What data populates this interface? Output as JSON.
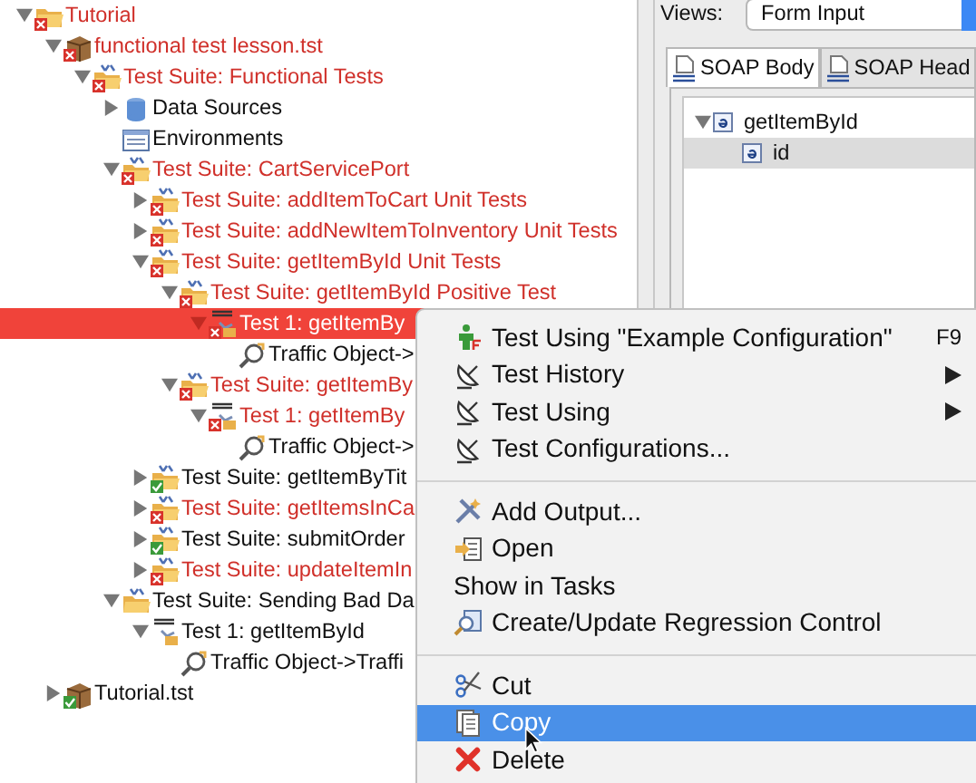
{
  "tree": [
    {
      "label": "Tutorial",
      "kind": "folder",
      "failed": true,
      "passed": false,
      "expanded": true,
      "selected": false,
      "children": [
        {
          "label": "functional test lesson.tst",
          "kind": "file",
          "failed": true,
          "passed": false,
          "expanded": true,
          "selected": false,
          "children": [
            {
              "label": "Test Suite: Functional Tests",
              "kind": "suite",
              "failed": true,
              "passed": false,
              "expanded": true,
              "selected": false,
              "children": [
                {
                  "label": "Data Sources",
                  "kind": "datasource",
                  "failed": false,
                  "passed": false,
                  "expanded": false,
                  "selected": false
                },
                {
                  "label": "Environments",
                  "kind": "environment",
                  "failed": false,
                  "passed": false,
                  "selected": false
                },
                {
                  "label": "Test Suite: CartServicePort",
                  "kind": "suite",
                  "failed": true,
                  "passed": false,
                  "expanded": true,
                  "selected": false,
                  "children": [
                    {
                      "label": "Test Suite: addItemToCart Unit Tests",
                      "kind": "suite",
                      "failed": true,
                      "passed": false,
                      "expanded": false,
                      "selected": false
                    },
                    {
                      "label": "Test Suite: addNewItemToInventory Unit Tests",
                      "kind": "suite",
                      "failed": true,
                      "passed": false,
                      "expanded": false,
                      "selected": false
                    },
                    {
                      "label": "Test Suite: getItemById Unit Tests",
                      "kind": "suite",
                      "failed": true,
                      "passed": false,
                      "expanded": true,
                      "selected": false,
                      "children": [
                        {
                          "label": "Test Suite: getItemById Positive Test",
                          "kind": "suite",
                          "failed": true,
                          "passed": false,
                          "expanded": true,
                          "selected": false,
                          "children": [
                            {
                              "label": "Test 1: getItemBy",
                              "kind": "soap",
                              "failed": true,
                              "passed": false,
                              "expanded": true,
                              "selected": true,
                              "children": [
                                {
                                  "label": "Traffic Object->",
                                  "kind": "traffic",
                                  "failed": false,
                                  "passed": false,
                                  "selected": false
                                }
                              ]
                            }
                          ]
                        },
                        {
                          "label": "Test Suite: getItemBy",
                          "kind": "suite",
                          "failed": true,
                          "passed": false,
                          "expanded": true,
                          "selected": false,
                          "children": [
                            {
                              "label": "Test 1: getItemBy",
                              "kind": "soap",
                              "failed": true,
                              "passed": false,
                              "expanded": true,
                              "selected": false,
                              "children": [
                                {
                                  "label": "Traffic Object->",
                                  "kind": "traffic",
                                  "failed": false,
                                  "passed": false,
                                  "selected": false
                                }
                              ]
                            }
                          ]
                        }
                      ]
                    },
                    {
                      "label": "Test Suite: getItemByTit",
                      "kind": "suite",
                      "failed": false,
                      "passed": true,
                      "expanded": false,
                      "selected": false
                    },
                    {
                      "label": "Test Suite: getItemsInCa",
                      "kind": "suite",
                      "failed": true,
                      "passed": false,
                      "expanded": false,
                      "selected": false
                    },
                    {
                      "label": "Test Suite: submitOrder",
                      "kind": "suite",
                      "failed": false,
                      "passed": true,
                      "expanded": false,
                      "selected": false
                    },
                    {
                      "label": "Test Suite: updateItemIn",
                      "kind": "suite",
                      "failed": true,
                      "passed": false,
                      "expanded": false,
                      "selected": false
                    }
                  ]
                },
                {
                  "label": "Test Suite: Sending Bad Da",
                  "kind": "suite",
                  "failed": false,
                  "passed": false,
                  "expanded": true,
                  "selected": false,
                  "children": [
                    {
                      "label": "Test 1: getItemById",
                      "kind": "soap",
                      "failed": false,
                      "passed": false,
                      "expanded": true,
                      "selected": false,
                      "children": [
                        {
                          "label": "Traffic Object->Traffi",
                          "kind": "traffic",
                          "failed": false,
                          "passed": false,
                          "selected": false
                        }
                      ]
                    }
                  ]
                }
              ]
            }
          ]
        },
        {
          "label": "Tutorial.tst",
          "kind": "file",
          "failed": false,
          "passed": true,
          "expanded": false,
          "selected": false
        }
      ]
    }
  ],
  "views_label": "Views:",
  "view_select": "Form Input",
  "tabs": [
    {
      "label": "SOAP Body",
      "selected": true
    },
    {
      "label": "SOAP Head",
      "selected": false
    }
  ],
  "element_tree": [
    {
      "label": "getItemById",
      "expanded": true,
      "selected": false,
      "children": [
        {
          "label": "id",
          "selected": true
        }
      ]
    }
  ],
  "context_menu": [
    {
      "kind": "run",
      "label": "Test Using \"Example Configuration\"",
      "shortcut": "F9",
      "submenu": false,
      "selected": false
    },
    {
      "kind": "dish",
      "label": "Test History",
      "submenu": true,
      "selected": false
    },
    {
      "kind": "dish",
      "label": "Test Using",
      "submenu": true,
      "selected": false
    },
    {
      "kind": "dish",
      "label": "Test Configurations...",
      "submenu": false,
      "selected": false
    },
    {
      "kind": "separator"
    },
    {
      "kind": "tools",
      "label": "Add Output...",
      "submenu": false,
      "selected": false
    },
    {
      "kind": "open",
      "label": "Open",
      "submenu": false,
      "selected": false
    },
    {
      "kind": "plain",
      "label": "Show in Tasks",
      "submenu": false,
      "selected": false
    },
    {
      "kind": "magnifier",
      "label": "Create/Update Regression Control",
      "submenu": false,
      "selected": false
    },
    {
      "kind": "separator"
    },
    {
      "kind": "scissors",
      "label": "Cut",
      "submenu": false,
      "selected": false
    },
    {
      "kind": "copy",
      "label": "Copy",
      "submenu": false,
      "selected": true
    },
    {
      "kind": "delete",
      "label": "Delete",
      "submenu": false,
      "selected": false
    }
  ]
}
